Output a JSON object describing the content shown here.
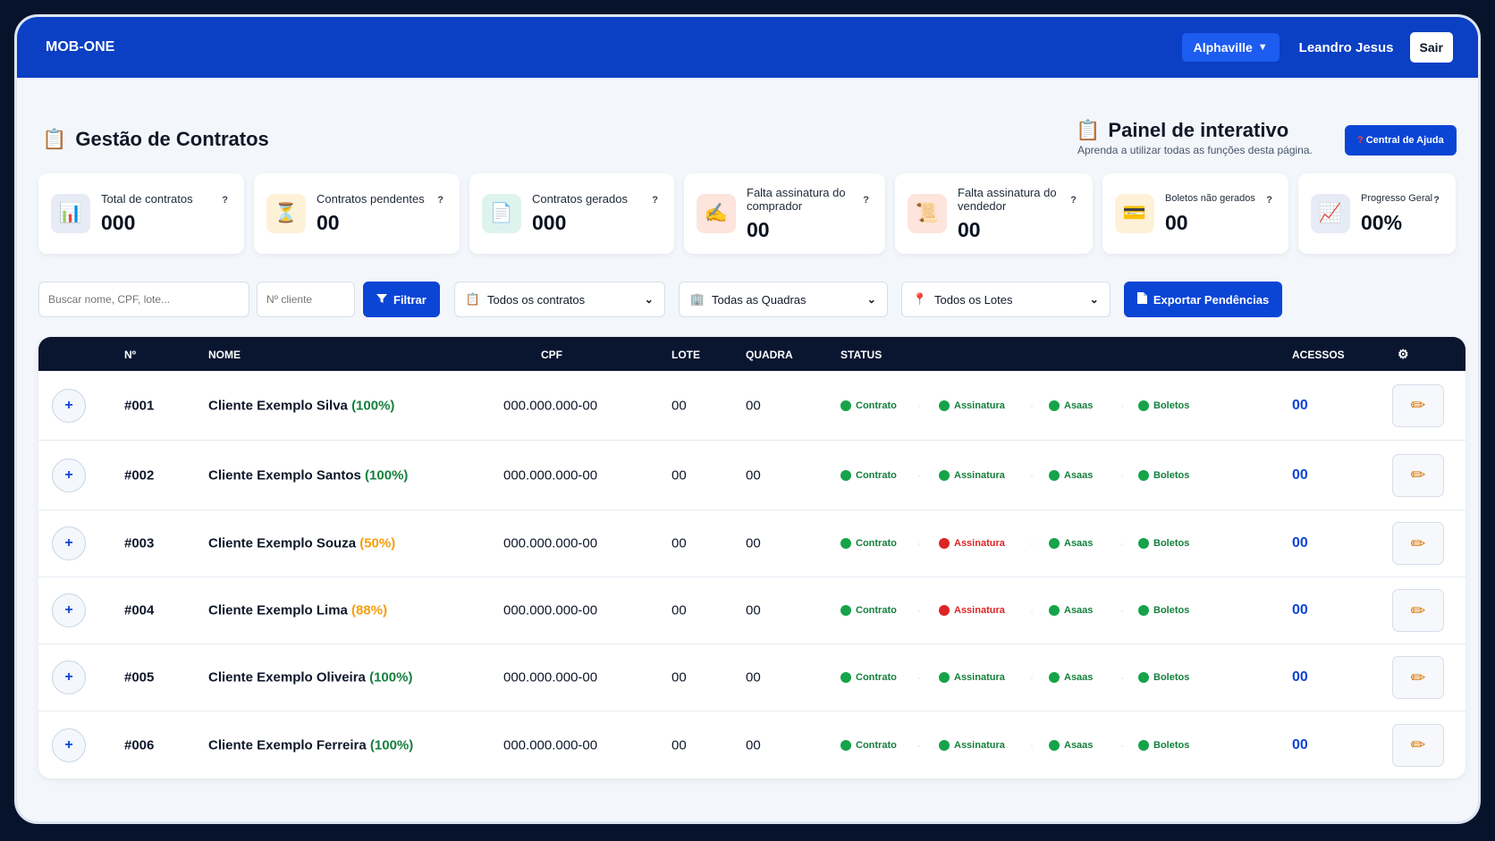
{
  "topbar": {
    "brand": "MOB-ONE",
    "region": "Alphaville",
    "user": "Leandro Jesus",
    "logout": "Sair"
  },
  "page": {
    "title": "Gestão de Contratos",
    "panel_title": "Painel de interativo",
    "panel_subtitle": "Aprenda a utilizar todas as funções desta página.",
    "help_button": "Central de Ajuda"
  },
  "cards": [
    {
      "label": "Total de contratos",
      "value": "000",
      "icon": "chart-icon",
      "glyph": "📊",
      "bg": "#e6ebf5"
    },
    {
      "label": "Contratos pendentes",
      "value": "00",
      "icon": "hourglass-icon",
      "glyph": "⏳",
      "bg": "#fdf1d8"
    },
    {
      "label": "Contratos gerados",
      "value": "000",
      "icon": "document-icon",
      "glyph": "📄",
      "bg": "#dff3ee"
    },
    {
      "label": "Falta assinatura do comprador",
      "value": "00",
      "icon": "signature-icon",
      "glyph": "✍",
      "bg": "#fde4dc"
    },
    {
      "label": "Falta assinatura do vendedor",
      "value": "00",
      "icon": "scroll-icon",
      "glyph": "📜",
      "bg": "#fde4dc"
    },
    {
      "label": "Boletos não gerados",
      "value": "00",
      "icon": "card-icon",
      "glyph": "💳",
      "bg": "#fdf1d8"
    },
    {
      "label": "Progresso Geral",
      "value": "00%",
      "icon": "trend-icon",
      "glyph": "📈",
      "bg": "#e6ebf5"
    }
  ],
  "card_help": "?",
  "filters": {
    "search_placeholder": "Buscar nome, CPF, lote...",
    "client_placeholder": "Nº cliente",
    "filter_button": "Filtrar",
    "contracts_select": "Todos os contratos",
    "blocks_select": "Todas as Quadras",
    "lots_select": "Todos os Lotes",
    "export_button": "Exportar Pendências"
  },
  "table": {
    "headers": {
      "num": "Nº",
      "name": "NOME",
      "cpf": "CPF",
      "lote": "LOTE",
      "quadra": "QUADRA",
      "status": "STATUS",
      "acessos": "ACESSOS"
    },
    "status_labels": [
      "Contrato",
      "Assinatura",
      "Asaas",
      "Boletos"
    ],
    "rows": [
      {
        "num": "#001",
        "name": "Cliente Exemplo Silva",
        "pct": "(100%)",
        "pct_color": "green",
        "cpf": "000.000.000-00",
        "lote": "00",
        "quadra": "00",
        "status": [
          "ok",
          "ok",
          "ok",
          "ok"
        ],
        "acessos": "00"
      },
      {
        "num": "#002",
        "name": "Cliente Exemplo Santos",
        "pct": "(100%)",
        "pct_color": "green",
        "cpf": "000.000.000-00",
        "lote": "00",
        "quadra": "00",
        "status": [
          "ok",
          "ok",
          "ok",
          "ok"
        ],
        "acessos": "00"
      },
      {
        "num": "#003",
        "name": "Cliente Exemplo Souza",
        "pct": "(50%)",
        "pct_color": "orange",
        "cpf": "000.000.000-00",
        "lote": "00",
        "quadra": "00",
        "status": [
          "ok",
          "bad",
          "ok",
          "ok"
        ],
        "acessos": "00"
      },
      {
        "num": "#004",
        "name": "Cliente Exemplo Lima",
        "pct": "(88%)",
        "pct_color": "orange",
        "cpf": "000.000.000-00",
        "lote": "00",
        "quadra": "00",
        "status": [
          "ok",
          "bad",
          "ok",
          "ok"
        ],
        "acessos": "00"
      },
      {
        "num": "#005",
        "name": "Cliente Exemplo Oliveira",
        "pct": "(100%)",
        "pct_color": "green",
        "cpf": "000.000.000-00",
        "lote": "00",
        "quadra": "00",
        "status": [
          "ok",
          "ok",
          "ok",
          "ok"
        ],
        "acessos": "00"
      },
      {
        "num": "#006",
        "name": "Cliente Exemplo Ferreira",
        "pct": "(100%)",
        "pct_color": "green",
        "cpf": "000.000.000-00",
        "lote": "00",
        "quadra": "00",
        "status": [
          "ok",
          "ok",
          "ok",
          "ok"
        ],
        "acessos": "00"
      }
    ]
  }
}
